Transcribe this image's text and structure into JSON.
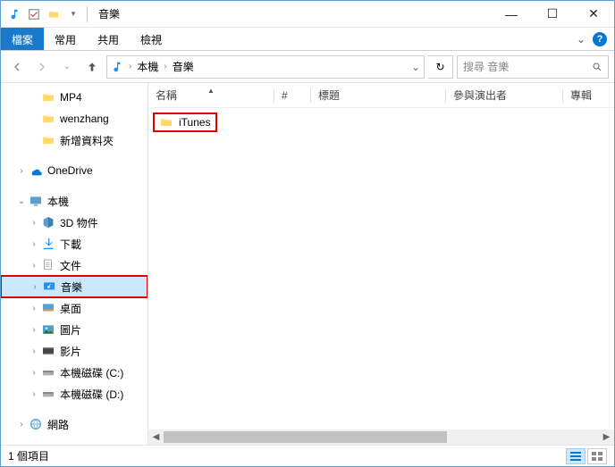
{
  "titlebar": {
    "title": "音樂",
    "min": "—",
    "max": "☐",
    "close": "✕"
  },
  "ribbon": {
    "file": "檔案",
    "home": "常用",
    "share": "共用",
    "view": "檢視",
    "expand": "⌄",
    "help": "?"
  },
  "addr": {
    "loc1": "本機",
    "loc2": "音樂",
    "dd": "⌄",
    "refresh": "↻",
    "search_placeholder": "搜尋 音樂",
    "search_icon": "🔍"
  },
  "sidebar": {
    "items": [
      {
        "indent": 2,
        "twisty": "",
        "icon": "folder",
        "label": "MP4"
      },
      {
        "indent": 2,
        "twisty": "",
        "icon": "folder",
        "label": "wenzhang"
      },
      {
        "indent": 2,
        "twisty": "",
        "icon": "folder",
        "label": "新增資料夾"
      },
      {
        "indent": 1,
        "twisty": "›",
        "icon": "onedrive",
        "label": "OneDrive",
        "gap": true
      },
      {
        "indent": 1,
        "twisty": "⌄",
        "icon": "pc",
        "label": "本機",
        "gap": true
      },
      {
        "indent": 2,
        "twisty": "›",
        "icon": "objects3d",
        "label": "3D 物件"
      },
      {
        "indent": 2,
        "twisty": "›",
        "icon": "downloads",
        "label": "下載"
      },
      {
        "indent": 2,
        "twisty": "›",
        "icon": "documents",
        "label": "文件"
      },
      {
        "indent": 2,
        "twisty": "›",
        "icon": "music",
        "label": "音樂",
        "selected": true,
        "highlight": true
      },
      {
        "indent": 2,
        "twisty": "›",
        "icon": "desktop",
        "label": "桌面"
      },
      {
        "indent": 2,
        "twisty": "›",
        "icon": "pictures",
        "label": "圖片"
      },
      {
        "indent": 2,
        "twisty": "›",
        "icon": "videos",
        "label": "影片"
      },
      {
        "indent": 2,
        "twisty": "›",
        "icon": "drive",
        "label": "本機磁碟 (C:)"
      },
      {
        "indent": 2,
        "twisty": "›",
        "icon": "drive",
        "label": "本機磁碟 (D:)"
      },
      {
        "indent": 1,
        "twisty": "›",
        "icon": "network",
        "label": "網路",
        "gap": true
      }
    ]
  },
  "columns": {
    "name": "名稱",
    "num": "#",
    "title": "標題",
    "artist": "參與演出者",
    "album": "專輯"
  },
  "files": [
    {
      "icon": "folder",
      "name": "iTunes",
      "highlight": true
    }
  ],
  "status": {
    "count": "1 個項目"
  }
}
